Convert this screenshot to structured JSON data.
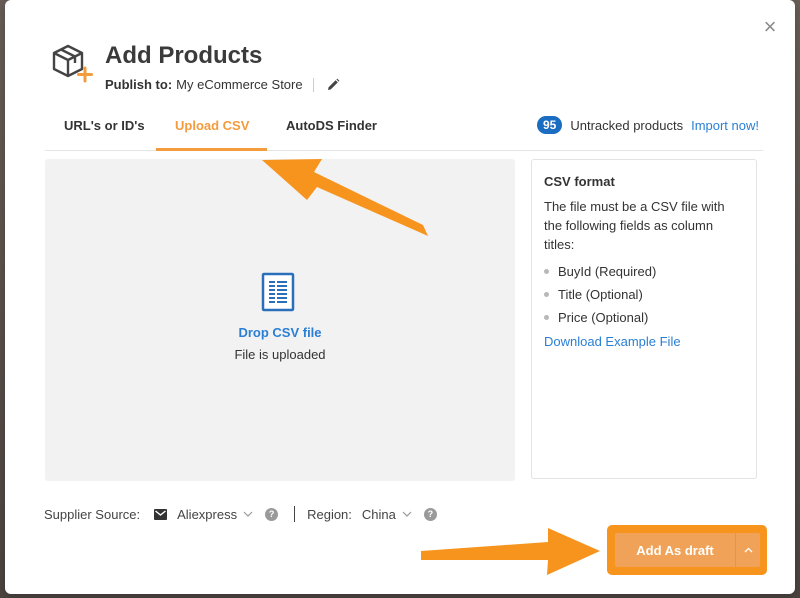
{
  "modal": {
    "title": "Add Products",
    "publish_label": "Publish to:",
    "publish_store": "My eCommerce Store",
    "close_glyph": "×"
  },
  "tabs": [
    {
      "label": "URL's or ID's",
      "active": false
    },
    {
      "label": "Upload CSV",
      "active": true
    },
    {
      "label": "AutoDS Finder",
      "active": false
    }
  ],
  "untracked": {
    "count": "95",
    "label": "Untracked products",
    "link": "Import now!"
  },
  "dropzone": {
    "title": "Drop CSV file",
    "subtitle": "File is uploaded"
  },
  "csv_format": {
    "title": "CSV format",
    "description": "The file must be a CSV file with the following fields as column titles:",
    "fields": [
      "BuyId (Required)",
      "Title (Optional)",
      "Price (Optional)"
    ],
    "link": "Download Example File"
  },
  "footer": {
    "supplier_label": "Supplier Source:",
    "supplier_value": "Aliexpress",
    "region_label": "Region:",
    "region_value": "China",
    "help_glyph": "?"
  },
  "actions": {
    "primary_label": "Add As draft",
    "caret_glyph": "^"
  },
  "colors": {
    "accent": "#f39c3d",
    "link": "#2a7fd4",
    "badge": "#1b6dc1",
    "button": "#f0a258",
    "annotation_arrow": "#f7941d"
  },
  "icons": [
    "box-plus-icon",
    "pencil-icon",
    "csv-file-icon",
    "mail-icon",
    "help-icon",
    "close-icon",
    "chevron-down-icon",
    "chevron-up-icon"
  ]
}
